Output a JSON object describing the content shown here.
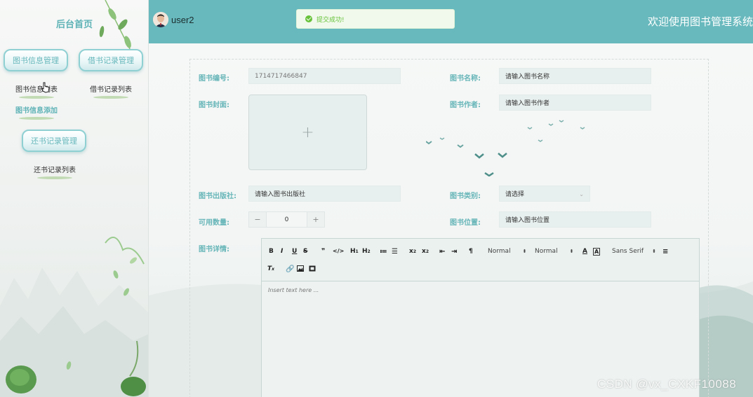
{
  "sidebar": {
    "home_title": "后台首页",
    "groups": [
      {
        "label": "图书信息管理",
        "items": [
          {
            "label": "图书信息列表"
          },
          {
            "label": "图书信息添加"
          }
        ]
      },
      {
        "label": "借书记录管理",
        "items": [
          {
            "label": "借书记录列表"
          }
        ]
      },
      {
        "label": "还书记录管理",
        "items": [
          {
            "label": "还书记录列表"
          }
        ]
      }
    ]
  },
  "header": {
    "username": "user2",
    "welcome": "欢迎使用图书管理系统"
  },
  "toast": {
    "message": "提交成功!",
    "icon": "success-check-icon",
    "color": "#67c23a"
  },
  "form": {
    "book_number": {
      "label": "图书编号:",
      "value": "1714717466847"
    },
    "book_name": {
      "label": "图书名称:",
      "placeholder": "请输入图书名称"
    },
    "cover": {
      "label": "图书封面:",
      "icon": "plus-icon"
    },
    "author": {
      "label": "图书作者:",
      "placeholder": "请输入图书作者"
    },
    "publisher": {
      "label": "图书出版社:",
      "placeholder": "请输入图书出版社"
    },
    "category": {
      "label": "图书类别:",
      "placeholder": "请选择"
    },
    "quantity": {
      "label": "可用数量:",
      "value": "0",
      "minus": "−",
      "plus": "+"
    },
    "location": {
      "label": "图书位置:",
      "placeholder": "请输入图书位置"
    },
    "details": {
      "label": "图书详情:",
      "placeholder": "Insert text here ...",
      "toolbar": {
        "header_select": "Normal",
        "size_select": "Normal",
        "font_select": "Sans Serif"
      }
    }
  },
  "theme": {
    "accent": "#68b9bd",
    "label_color": "#66b5b8"
  },
  "watermark": "CSDN @vx_CXKF10088"
}
